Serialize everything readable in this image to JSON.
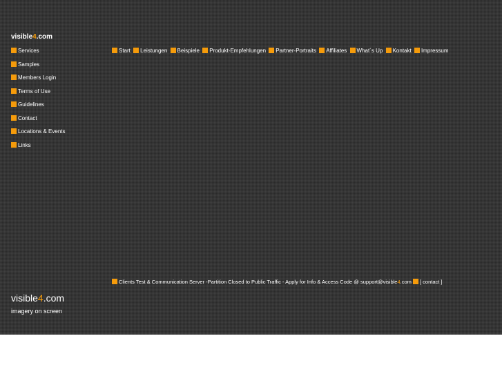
{
  "colors": {
    "background": "#2a2a2a",
    "accent": "#f59b0b",
    "text": "#ffffff"
  },
  "logo": {
    "prefix": "visible",
    "digit": "4",
    "suffix": ".com"
  },
  "side_nav": {
    "marker_icon": "orange-square-icon",
    "items": [
      {
        "label": "Services"
      },
      {
        "label": "Samples"
      },
      {
        "label": "Members Login"
      },
      {
        "label": "Terms of Use"
      },
      {
        "label": "Guidelines"
      },
      {
        "label": "Contact"
      },
      {
        "label": "Locations & Events"
      },
      {
        "label": "Links"
      }
    ]
  },
  "top_nav": {
    "items": [
      {
        "label": "Start"
      },
      {
        "label": "Leistungen"
      },
      {
        "label": "Beispiele"
      },
      {
        "label": "Produkt-Empfehlungen"
      },
      {
        "label": "Partner-Portraits"
      },
      {
        "label": "Affiliates"
      },
      {
        "label": "What´s Up"
      },
      {
        "label": "Kontakt"
      },
      {
        "label": "Impressum"
      }
    ]
  },
  "footer_notice": {
    "text_before": "Clients Test & Communication Server -Partition Closed to Public Traffic - Apply for Info & Access Code @ support@visible",
    "digit": "4",
    "text_after": ".com",
    "contact_label": "[ contact ]"
  },
  "brand": {
    "prefix": "visible",
    "digit": "4",
    "suffix": ".com",
    "tagline": "imagery on screen"
  }
}
